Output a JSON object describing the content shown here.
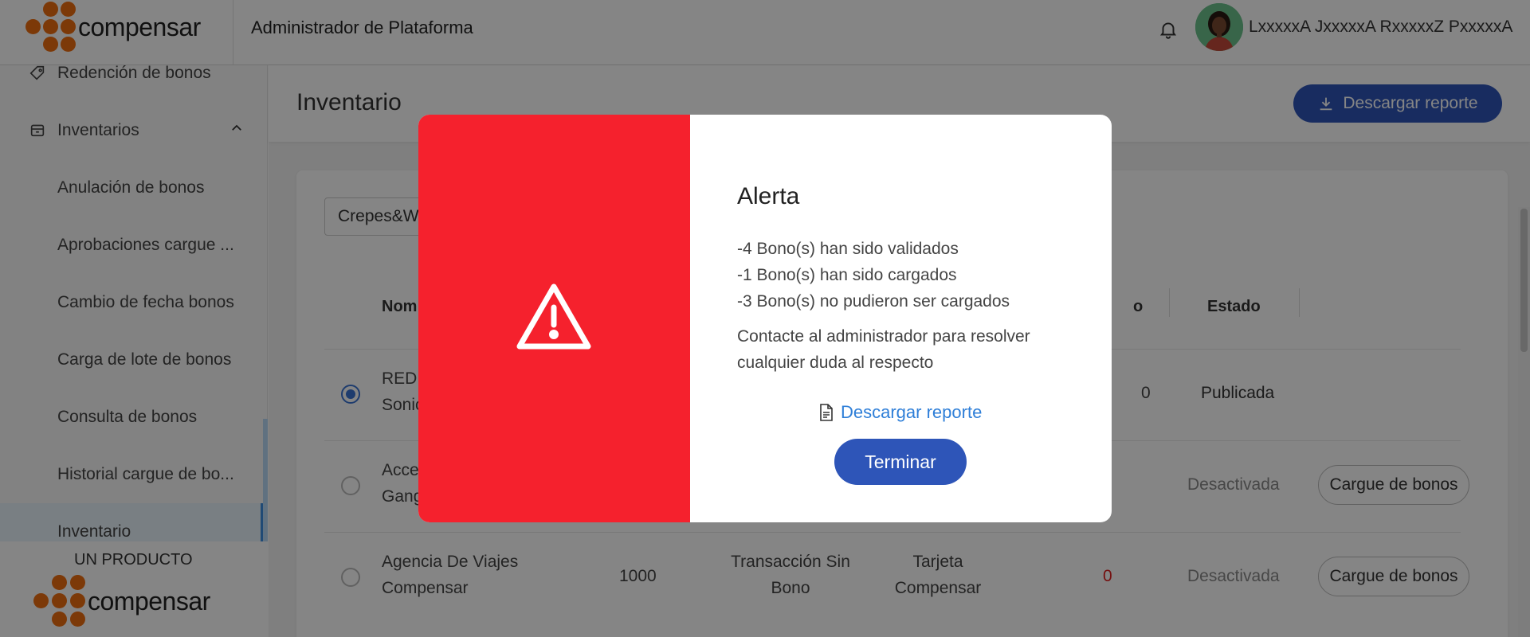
{
  "header": {
    "brand": "compensar",
    "app_title": "Administrador de Plataforma",
    "user_name": "LxxxxxA JxxxxxA RxxxxxZ PxxxxxA"
  },
  "sidebar": {
    "items": [
      {
        "label": "Redención de bonos",
        "icon": "tag-icon"
      },
      {
        "label": "Inventarios",
        "icon": "box-icon",
        "expanded": true
      },
      {
        "label": "Anulación de bonos"
      },
      {
        "label": "Aprobaciones cargue ..."
      },
      {
        "label": "Cambio de fecha bonos"
      },
      {
        "label": "Carga de lote de bonos"
      },
      {
        "label": "Consulta de bonos"
      },
      {
        "label": "Historial cargue de bo..."
      },
      {
        "label": "Inventario",
        "active": true
      }
    ],
    "footer_label": "UN PRODUCTO",
    "footer_brand": "compensar"
  },
  "main": {
    "page_title": "Inventario",
    "download_report": "Descargar reporte",
    "search_value": "Crepes&W",
    "columns": [
      "Nom",
      "o",
      "Estado"
    ],
    "rows": [
      {
        "name": "RED",
        "name2": "Sonic",
        "col3": "",
        "col4": "",
        "col5": "",
        "count": "0",
        "state": "Publicada",
        "action": "",
        "selected": true
      },
      {
        "name": "Acce",
        "name2": "Gang",
        "col3": "",
        "col4": "",
        "col5": "",
        "count": "",
        "state": "Desactivada",
        "action": "Cargue de bonos",
        "selected": false
      },
      {
        "name": "Agencia De Viajes",
        "name2": "Compensar",
        "col3": "1000",
        "col4": "Transacción Sin",
        "col4b": "Bono",
        "col5": "Tarjeta",
        "col5b": "Compensar",
        "count": "0",
        "state": "Desactivada",
        "action": "Cargue de bonos",
        "selected": false
      }
    ]
  },
  "modal": {
    "title": "Alerta",
    "lines": [
      "-4 Bono(s) han sido validados",
      "-1 Bono(s) han sido cargados",
      "-3 Bono(s) no pudieron ser cargados"
    ],
    "contact": "Contacte al administrador para resolver cualquier duda al respecto",
    "download_link": "Descargar reporte",
    "finish_button": "Terminar"
  },
  "colors": {
    "primary": "#2e55b8",
    "alert": "#f5212d",
    "brand_orange": "#ed6d10",
    "link": "#2f7fd8",
    "count_zero": "#e02020"
  }
}
